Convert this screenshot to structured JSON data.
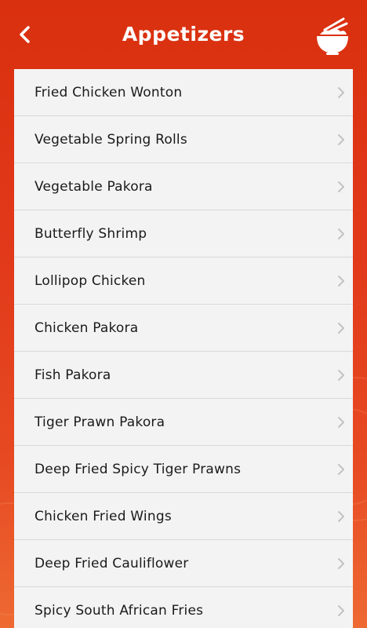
{
  "header": {
    "title": "Appetizers",
    "back_icon": "chevron-left-icon",
    "logo_icon": "rice-bowl-chopsticks-icon"
  },
  "colors": {
    "header_background": "#d9300f",
    "list_background": "#f3f3f3",
    "divider": "#d9d9d9",
    "item_text": "#1a1a1a",
    "chevron": "#c2c2c2",
    "title_text": "#ffffff"
  },
  "menu": {
    "items": [
      {
        "label": "Fried Chicken Wonton"
      },
      {
        "label": "Vegetable Spring Rolls"
      },
      {
        "label": "Vegetable Pakora"
      },
      {
        "label": "Butterfly Shrimp"
      },
      {
        "label": "Lollipop Chicken"
      },
      {
        "label": "Chicken Pakora"
      },
      {
        "label": "Fish Pakora"
      },
      {
        "label": "Tiger Prawn Pakora"
      },
      {
        "label": "Deep Fried Spicy Tiger Prawns"
      },
      {
        "label": "Chicken Fried Wings"
      },
      {
        "label": "Deep Fried Cauliflower"
      },
      {
        "label": "Spicy South African Fries"
      }
    ]
  }
}
